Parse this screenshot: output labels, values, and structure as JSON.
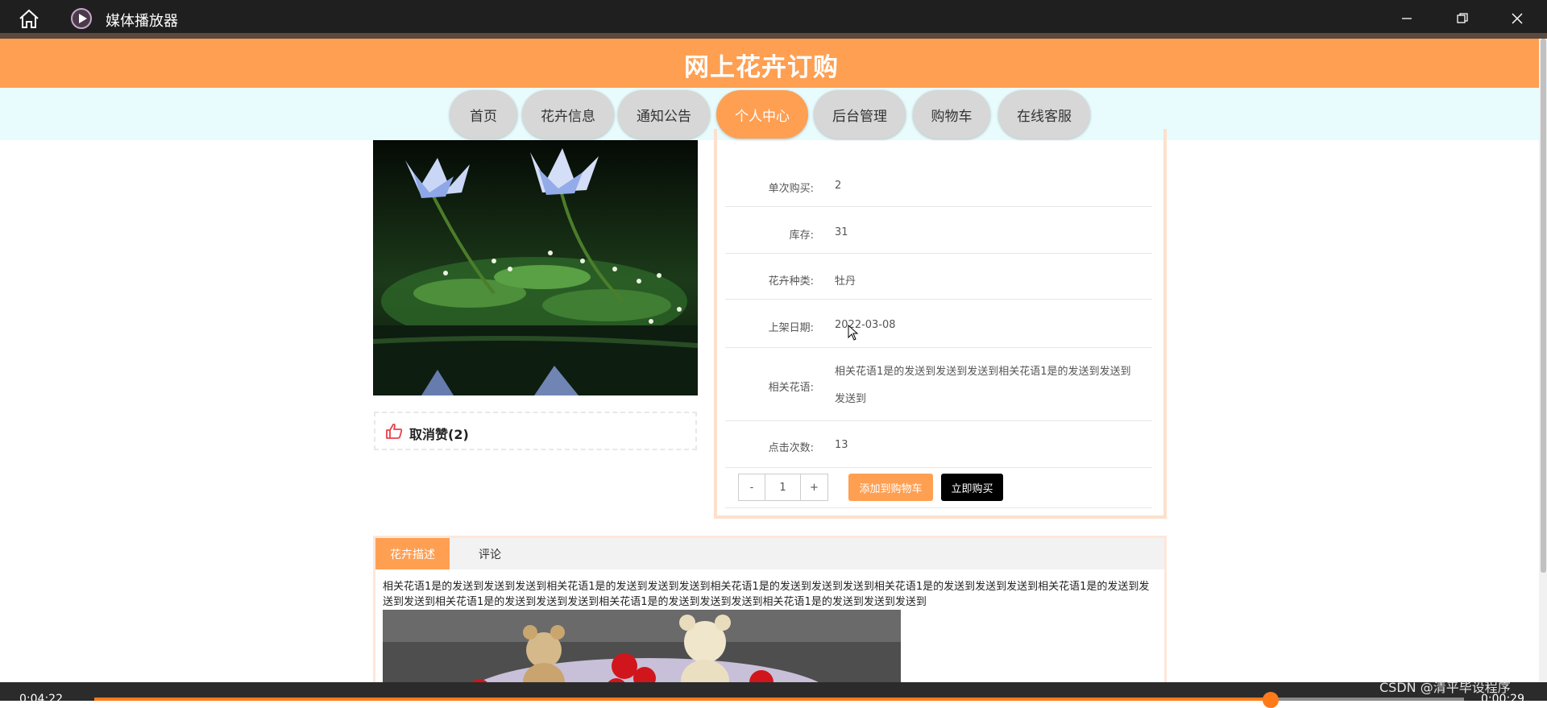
{
  "window": {
    "title": "媒体播放器"
  },
  "site": {
    "title": "网上花卉订购"
  },
  "nav": [
    {
      "label": "首页",
      "active": false
    },
    {
      "label": "花卉信息",
      "active": false
    },
    {
      "label": "通知公告",
      "active": false
    },
    {
      "label": "个人中心",
      "active": true
    },
    {
      "label": "后台管理",
      "active": false
    },
    {
      "label": "购物车",
      "active": false
    },
    {
      "label": "在线客服",
      "active": false
    }
  ],
  "product": {
    "like_label": "取消赞(2)",
    "rows": [
      {
        "label": "单次购买:",
        "value": "2"
      },
      {
        "label": "库存:",
        "value": "31"
      },
      {
        "label": "花卉种类:",
        "value": "牡丹"
      },
      {
        "label": "上架日期:",
        "value": "2022-03-08"
      },
      {
        "label": "相关花语:",
        "value": "相关花语1是的发送到发送到发送到相关花语1是的发送到发送到发送到"
      },
      {
        "label": "点击次数:",
        "value": "13"
      }
    ],
    "quantity": {
      "minus": "-",
      "value": "1",
      "plus": "+"
    },
    "add_to_cart": "添加到购物车",
    "buy_now": "立即购买"
  },
  "tabs": [
    {
      "label": "花卉描述",
      "active": true
    },
    {
      "label": "评论",
      "active": false
    }
  ],
  "description": "相关花语1是的发送到发送到发送到相关花语1是的发送到发送到发送到相关花语1是的发送到发送到发送到相关花语1是的发送到发送到发送到相关花语1是的发送到发送到发送到相关花语1是的发送到发送到发送到相关花语1是的发送到发送到发送到相关花语1是的发送到发送到发送到",
  "player": {
    "elapsed": "0:04:22",
    "remaining": "0:00:29",
    "progress": 0.86
  },
  "watermark": "CSDN @清平毕设程序",
  "colors": {
    "accent": "#ff9f52",
    "nav_bg": "#e8fbfd",
    "titlebar": "#1f1f1f"
  }
}
